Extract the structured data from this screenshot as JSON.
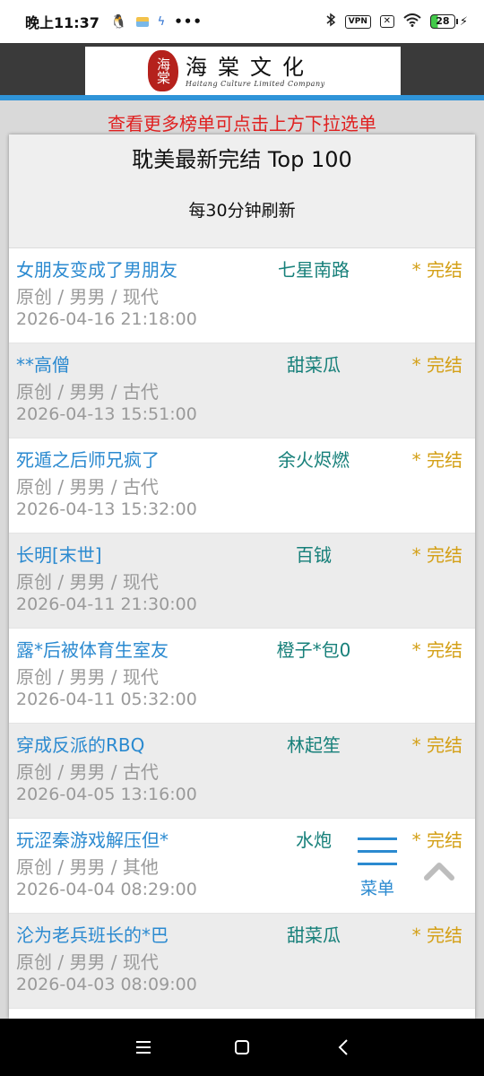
{
  "status_bar": {
    "time": "晚上11:37",
    "vpn": "VPN",
    "battery": "28"
  },
  "logo": {
    "seal_text": "海棠",
    "name_cn": "海棠文化",
    "name_en": "Haitang Culture Limited Company"
  },
  "notice": "查看更多榜单可点击上方下拉选单",
  "list": {
    "title": "耽美最新完结 Top 100",
    "subtitle": "每30分钟刷新",
    "items": [
      {
        "title": "女朋友变成了男朋友",
        "author": "七星南路",
        "status": "* 完结",
        "tags": "原创 / 男男 / 现代",
        "date": "2026-04-16 21:18:00"
      },
      {
        "title": "**高僧",
        "author": "甜菜瓜",
        "status": "* 完结",
        "tags": "原创 / 男男 / 古代",
        "date": "2026-04-13 15:51:00"
      },
      {
        "title": "死遁之后师兄疯了",
        "author": "余火烬燃",
        "status": "* 完结",
        "tags": "原创 / 男男 / 古代",
        "date": "2026-04-13 15:32:00"
      },
      {
        "title": "长明[末世]",
        "author": "百钺",
        "status": "* 完结",
        "tags": "原创 / 男男 / 现代",
        "date": "2026-04-11 21:30:00"
      },
      {
        "title": "露*后被体育生室友",
        "author": "橙子*包0",
        "status": "* 完结",
        "tags": "原创 / 男男 / 现代",
        "date": "2026-04-11 05:32:00"
      },
      {
        "title": "穿成反派的RBQ",
        "author": "林起笙",
        "status": "* 完结",
        "tags": "原创 / 男男 / 古代",
        "date": "2026-04-05 13:16:00"
      },
      {
        "title": "玩涩秦游戏解压但*",
        "author": "水炮",
        "status": "* 完结",
        "tags": "原创 / 男男 / 其他",
        "date": "2026-04-04 08:29:00"
      },
      {
        "title": "沦为老兵班长的*巴",
        "author": "甜菜瓜",
        "status": "* 完结",
        "tags": "原创 / 男男 / 现代",
        "date": "2026-04-03 08:09:00"
      }
    ]
  },
  "menu_label": "菜单",
  "colors": {
    "header_dark": "#3a3a3a",
    "accent_blue": "#2b8ad0",
    "notice_red": "#e02020",
    "author_teal": "#17807a",
    "status_gold": "#d4a017"
  }
}
